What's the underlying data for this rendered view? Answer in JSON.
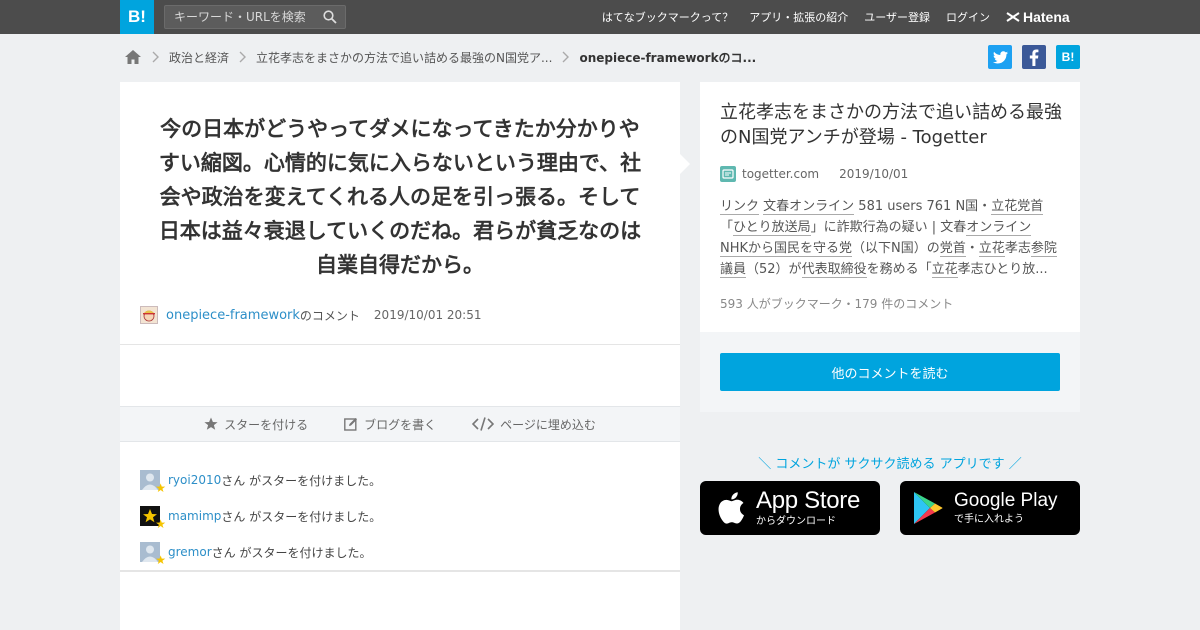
{
  "header": {
    "logo": "B!",
    "search_placeholder": "キーワード・URLを検索",
    "nav": [
      "はてなブックマークって？",
      "アプリ・拡張の紹介",
      "ユーザー登録",
      "ログイン"
    ],
    "brand": "Hatena"
  },
  "breadcrumb": {
    "items": [
      "政治と経済",
      "立花孝志をまさかの方法で追い詰める最強のN国党ア...",
      "onepiece-frameworkのコ..."
    ]
  },
  "share": {
    "hatena_label": "B!"
  },
  "comment": {
    "text": "今の日本がどうやってダメになってきたか分かりやすい縮図。心情的に気に入らないという理由で、社会や政治を変えてくれる人の足を引っ張る。そして日本は益々衰退していくのだね。君らが貧乏なのは自業自得だから。",
    "author": "onepiece-framework",
    "author_suffix": "のコメント",
    "date": "2019/10/01 20:51"
  },
  "actions": {
    "star": "スターを付ける",
    "blog": "ブログを書く",
    "embed": "ページに埋め込む"
  },
  "stars": [
    {
      "user": "ryoi2010",
      "suffix": "さん がスターを付けました。"
    },
    {
      "user": "mamimp",
      "suffix": "さん がスターを付けました。"
    },
    {
      "user": "gremor",
      "suffix": "さん がスターを付けました。"
    }
  ],
  "entry": {
    "title": "立花孝志をまさかの方法で追い詰める最強のN国党アンチが登場 - Togetter",
    "domain": "togetter.com",
    "date": "2019/10/01",
    "count": "593 人がブックマーク・179 件のコメント",
    "more_button": "他のコメントを読む"
  },
  "promo": {
    "text": "＼ コメントが サクサク読める アプリです ／",
    "appstore_big": "App Store",
    "appstore_small": "からダウンロード",
    "gplay_big": "Google Play",
    "gplay_small": "で手に入れよう"
  },
  "colors": {
    "accent": "#00a4de",
    "topbar": "#4c4c4c",
    "link": "#2d8fc8"
  }
}
